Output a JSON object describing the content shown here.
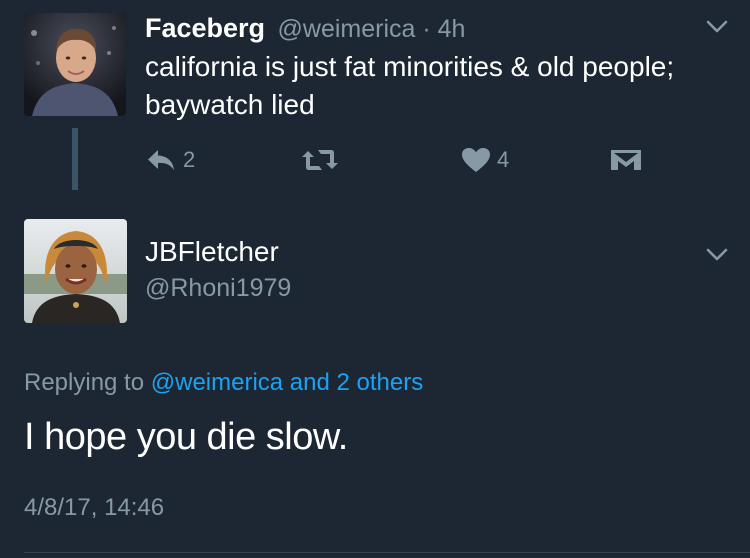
{
  "tweet": {
    "author_name": "Faceberg",
    "author_handle": "@weimerica",
    "time_sep": " · ",
    "time": "4h",
    "text": "california is just fat minorities & old people; baywatch lied",
    "actions": {
      "reply": {
        "icon": "reply-icon",
        "count": "2"
      },
      "retweet": {
        "icon": "retweet-icon",
        "count": ""
      },
      "like": {
        "icon": "heart-icon",
        "count": "4"
      },
      "dm": {
        "icon": "envelope-icon"
      }
    }
  },
  "reply": {
    "author_name": "JBFletcher",
    "author_handle": "@Rhoni1979",
    "replying_prefix": "Replying to ",
    "replying_targets": "@weimerica and 2 others",
    "text": "I hope you die slow.",
    "timestamp": "4/8/17, 14:46"
  },
  "colors": {
    "background": "#1c2733",
    "secondary_text": "#8899a6",
    "link": "#1da1f2",
    "thread_line": "#3d5466"
  }
}
